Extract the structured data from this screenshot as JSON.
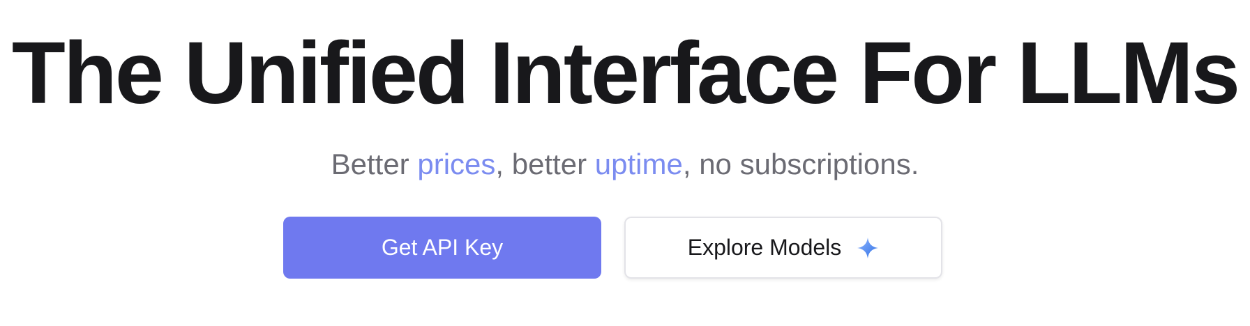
{
  "hero": {
    "title": "The Unified Interface For LLMs",
    "subtitle": {
      "part1": "Better ",
      "link1": "prices",
      "part2": ", better ",
      "link2": "uptime",
      "part3": ", no subscriptions."
    }
  },
  "actions": {
    "primary_label": "Get API Key",
    "secondary_label": "Explore Models",
    "secondary_icon": "sparkle-icon"
  },
  "colors": {
    "title": "#18181b",
    "subtitle": "#6b6b73",
    "accent": "#7b8cf0",
    "primary_button": "#6f79ef",
    "secondary_border": "#e3e3e8"
  }
}
